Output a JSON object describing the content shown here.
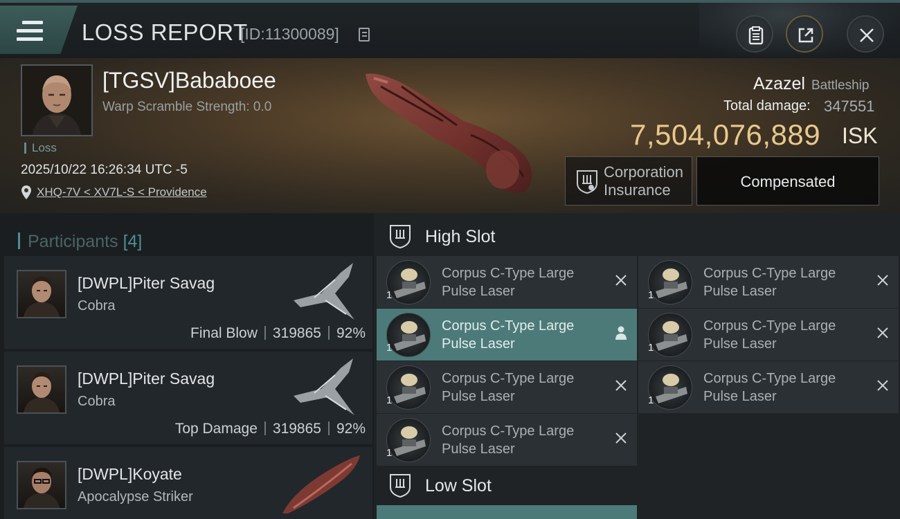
{
  "header": {
    "title": "LOSS REPORT",
    "report_id": "[ID:11300089]",
    "icons": [
      "menu-icon",
      "copy-icon",
      "clipboard-icon",
      "share-icon",
      "close-icon"
    ]
  },
  "victim": {
    "name": "[TGSV]Bababoee",
    "warp_scramble": "Warp Scramble Strength: 0.0",
    "status": "Loss",
    "time": "2025/10/22 16:26:34 UTC -5",
    "location": "XHQ-7V < XV7L-S < Providence",
    "ship_name": "Azazel",
    "ship_class": "Battleship",
    "total_damage_label": "Total damage:",
    "total_damage": "347551",
    "isk_value": "7,504,076,889",
    "isk_unit": "ISK",
    "insurance_label": "Corporation Insurance",
    "compensated_label": "Compensated"
  },
  "participants": {
    "label": "Participants",
    "count": "[4]",
    "rows": [
      {
        "name": "[DWPL]Piter Savag",
        "ship": "Cobra",
        "role": "Final Blow",
        "damage": "319865",
        "percent": "92%"
      },
      {
        "name": "[DWPL]Piter Savag",
        "ship": "Cobra",
        "role": "Top Damage",
        "damage": "319865",
        "percent": "92%"
      },
      {
        "name": "[DWPL]Koyate",
        "ship": "Apocalypse Striker",
        "role": "",
        "damage": "",
        "percent": ""
      }
    ]
  },
  "fitting": {
    "high_slot_label": "High Slot",
    "low_slot_label": "Low Slot",
    "high_slot": [
      {
        "name": "Corpus C-Type Large Pulse Laser",
        "qty": "1",
        "active": false
      },
      {
        "name": "Corpus C-Type Large Pulse Laser",
        "qty": "1",
        "active": false
      },
      {
        "name": "Corpus C-Type Large Pulse Laser",
        "qty": "1",
        "active": true
      },
      {
        "name": "Corpus C-Type Large Pulse Laser",
        "qty": "1",
        "active": false
      },
      {
        "name": "Corpus C-Type Large Pulse Laser",
        "qty": "1",
        "active": false
      },
      {
        "name": "Corpus C-Type Large Pulse Laser",
        "qty": "1",
        "active": false
      },
      {
        "name": "Corpus C-Type Large Pulse Laser",
        "qty": "1",
        "active": false
      }
    ]
  },
  "colors": {
    "accent": "#4b7a79",
    "isk": "#e9c98c",
    "background": "#15191d"
  }
}
